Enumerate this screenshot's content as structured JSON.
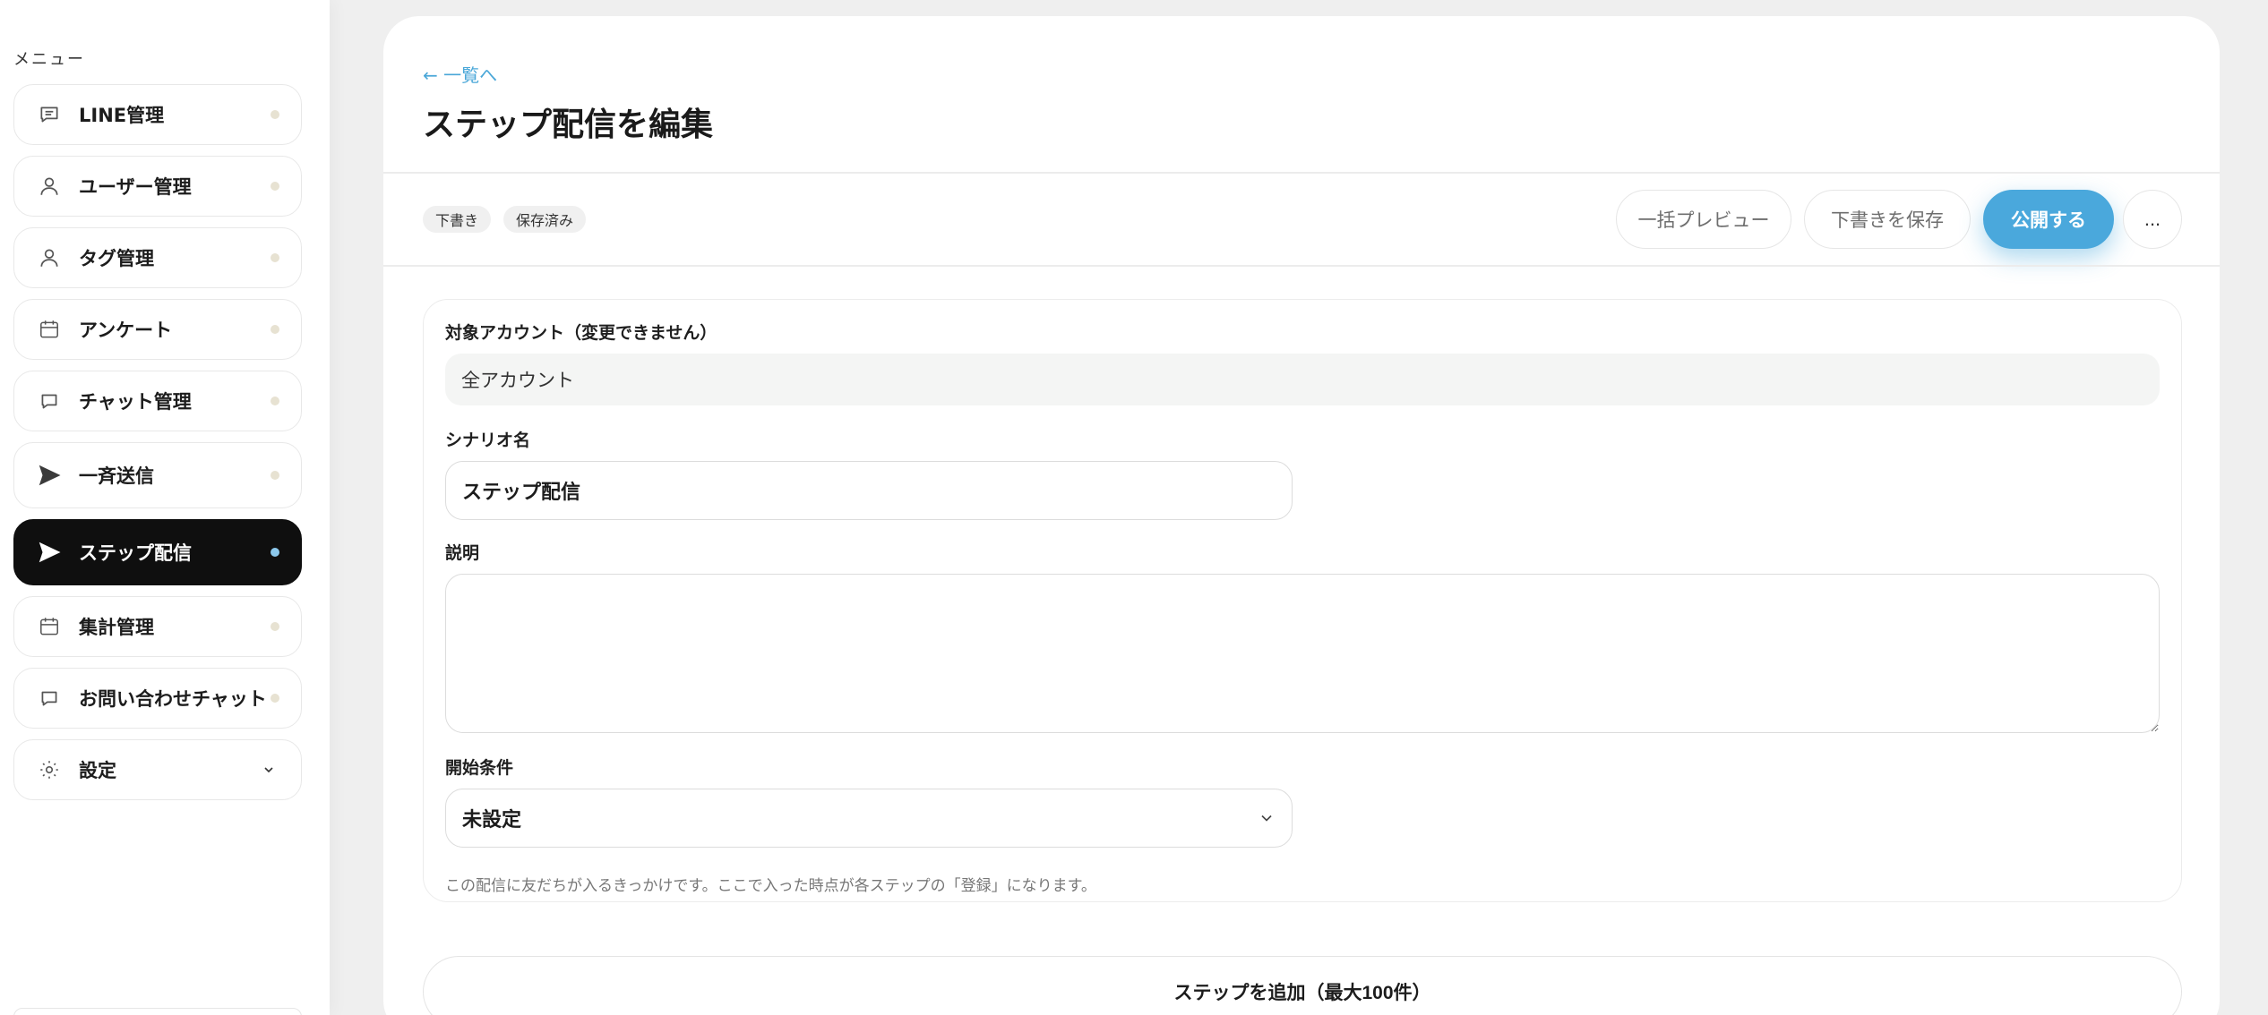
{
  "sidebar": {
    "heading": "メニュー",
    "items": [
      {
        "label": "LINE管理",
        "icon": "chat-lines-icon",
        "active": false
      },
      {
        "label": "ユーザー管理",
        "icon": "user-icon",
        "active": false
      },
      {
        "label": "タグ管理",
        "icon": "user-icon",
        "active": false
      },
      {
        "label": "アンケート",
        "icon": "calendar-icon",
        "active": false
      },
      {
        "label": "チャット管理",
        "icon": "chat-bubble-icon",
        "active": false
      },
      {
        "label": "一斉送信",
        "icon": "send-icon",
        "active": false
      },
      {
        "label": "ステップ配信",
        "icon": "send-icon",
        "active": true
      },
      {
        "label": "集計管理",
        "icon": "calendar-icon",
        "active": false
      },
      {
        "label": "お問い合わせチャット",
        "icon": "chat-bubble-icon",
        "active": false
      },
      {
        "label": "設定",
        "icon": "gear-icon",
        "active": false,
        "expandable": true
      }
    ],
    "colors": {
      "active_bg": "#0f0f0f",
      "dot": "#e7e2d2",
      "active_dot": "#8cc8ec"
    }
  },
  "header": {
    "back_link": "← 一覧へ",
    "title": "ステップ配信を編集"
  },
  "toolbar": {
    "badges": [
      "下書き",
      "保存済み"
    ],
    "bulk_preview": "一括プレビュー",
    "save_draft": "下書きを保存",
    "publish": "公開する",
    "more": "...",
    "accent": "#4aa8dc"
  },
  "form": {
    "account_label": "対象アカウント（変更できません）",
    "account_value": "全アカウント",
    "scenario_label": "シナリオ名",
    "scenario_value": "ステップ配信",
    "description_label": "説明",
    "description_value": "",
    "start_label": "開始条件",
    "start_value": "未設定",
    "start_help": "この配信に友だちが入るきっかけです。ここで入った時点が各ステップの「登録」になります。"
  },
  "add_step": {
    "label": "ステップを追加（最大100件）"
  }
}
